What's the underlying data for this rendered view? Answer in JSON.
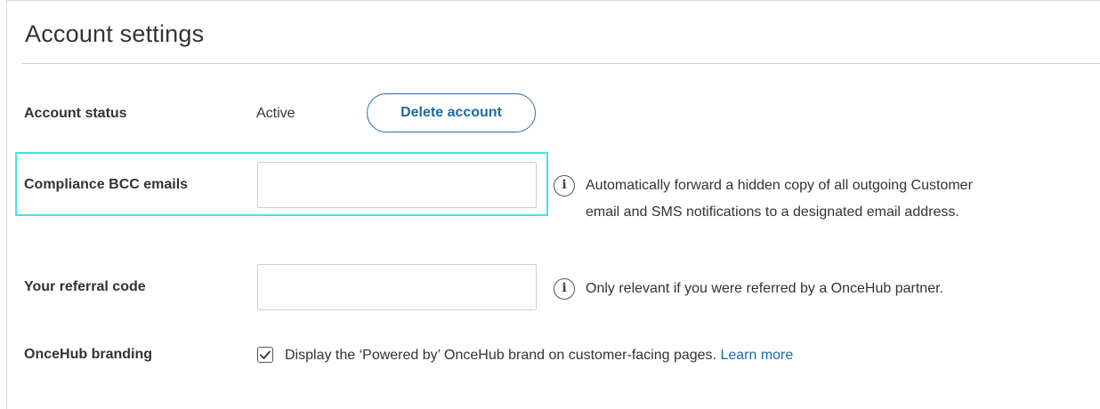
{
  "page": {
    "title": "Account settings"
  },
  "account_status": {
    "label": "Account status",
    "value": "Active",
    "delete_button": "Delete account"
  },
  "compliance_bcc": {
    "label": "Compliance BCC emails",
    "value": "",
    "help_line1": "Automatically forward a hidden copy of all outgoing Customer",
    "help_line2": "email and SMS notifications to a designated email address.",
    "icon": "info-icon"
  },
  "referral": {
    "label": "Your referral code",
    "value": "",
    "help": "Only relevant if you were referred by a OnceHub partner.",
    "icon": "info-icon"
  },
  "branding": {
    "label": "OnceHub branding",
    "checked": true,
    "text": "Display the ‘Powered by’ OnceHub brand on customer-facing pages.",
    "link": "Learn more"
  },
  "colors": {
    "accent": "#1f6aa5",
    "highlight": "#3ee3ef",
    "text": "#333333",
    "border": "#cccccc"
  }
}
